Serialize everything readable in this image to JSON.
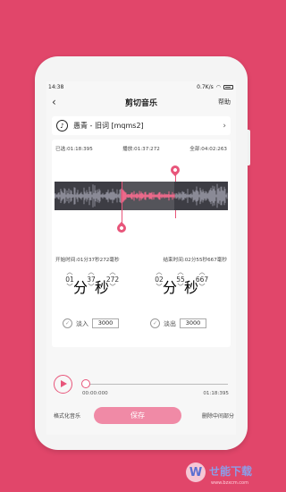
{
  "status": {
    "time": "14:38",
    "speed": "0.7K/s",
    "battery_icon": "battery-icon"
  },
  "header": {
    "title": "剪切音乐",
    "help": "帮助",
    "back": "‹"
  },
  "song": {
    "name": "愚青 - 旧词 [mqms2]"
  },
  "times": {
    "selected": "已选:01:18:395",
    "playing": "播放:01:37:272",
    "total": "全部:04:02:263"
  },
  "labels": {
    "start_time": "开始时间:01分37秒272毫秒",
    "end_time": "结束时间:02分55秒667毫秒"
  },
  "start": {
    "min": "01",
    "min_unit": "分",
    "sec": "37",
    "sec_unit": "秒",
    "ms": "272"
  },
  "end": {
    "min": "02",
    "min_unit": "分",
    "sec": "55",
    "sec_unit": "秒",
    "ms": "667"
  },
  "fade_in": {
    "label": "淡入",
    "value": "3000"
  },
  "fade_out": {
    "label": "淡出",
    "value": "3000"
  },
  "player": {
    "current": "00:00:000",
    "end": "01:18:395"
  },
  "bottom": {
    "format": "格式化音乐",
    "save": "保存",
    "delete": "删除中间部分"
  },
  "watermark": {
    "text": "せ能下载",
    "url": "www.bzxcm.com"
  },
  "colors": {
    "accent": "#e8557a",
    "background": "#e1466a",
    "save": "#f08aa6"
  }
}
